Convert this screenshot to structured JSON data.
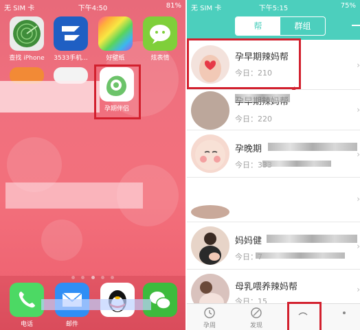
{
  "left": {
    "status": {
      "carrier": "无 SIM 卡",
      "time": "下午4:50",
      "battery": "81%"
    },
    "apps": [
      {
        "label": "查找 iPhone"
      },
      {
        "label": "3533手机..."
      },
      {
        "label": "好壁纸"
      },
      {
        "label": "炫表情"
      },
      {
        "label": "孕期伴侣"
      }
    ],
    "dock": [
      {
        "label": "电话"
      },
      {
        "label": "邮件"
      },
      {
        "label": ""
      },
      {
        "label": ""
      }
    ]
  },
  "right": {
    "status": {
      "carrier": "无 SIM 卡",
      "time": "下午5:15",
      "battery": "75%"
    },
    "tabs": {
      "active": "帮",
      "inactive": "群组"
    },
    "groups": [
      {
        "title": "孕早期辣妈帮",
        "today": "今日：210"
      },
      {
        "title": "孕早期辣妈帮",
        "today": "今日：220"
      },
      {
        "title": "孕晚期",
        "today": "今日：333"
      },
      {
        "title": "",
        "today": ""
      },
      {
        "title": "妈妈健",
        "today": "今日：7"
      },
      {
        "title": "母乳喂养辣妈帮",
        "today": "今日：15"
      }
    ],
    "bottom_tabs": [
      {
        "label": "孕周"
      },
      {
        "label": "发现"
      },
      {
        "label": ""
      }
    ]
  }
}
